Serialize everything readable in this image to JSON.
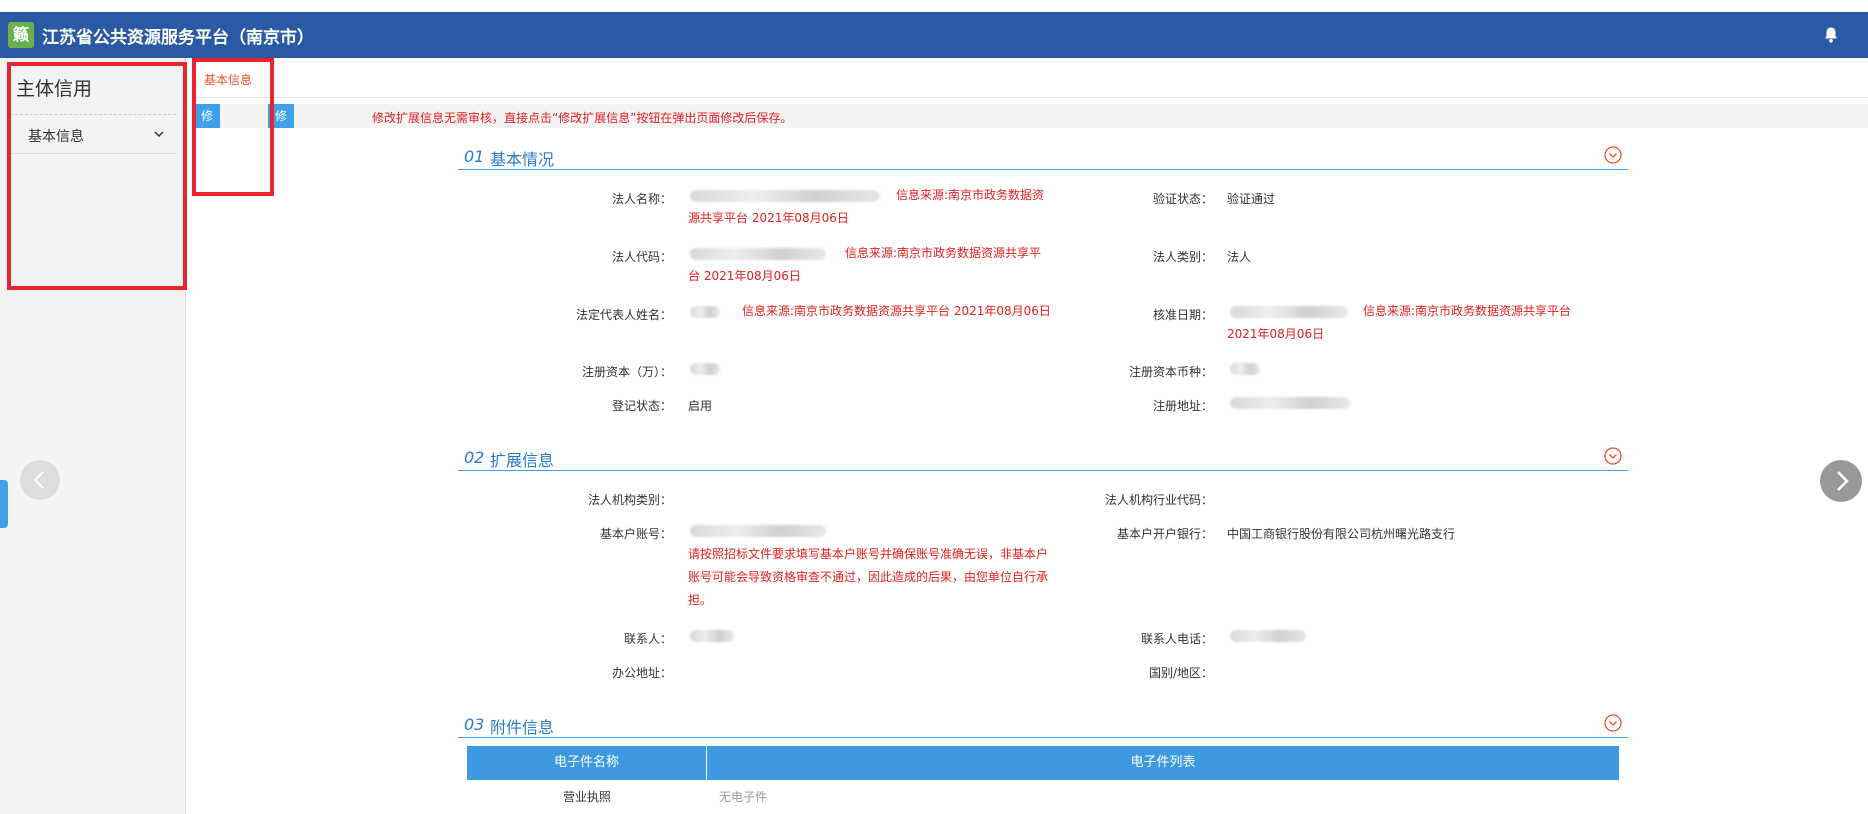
{
  "app": {
    "logo_glyph": "籁",
    "title": "江苏省公共资源服务平台（南京市）"
  },
  "sidebar": {
    "title": "主体信用",
    "items": [
      {
        "label": "基本信息"
      }
    ]
  },
  "tabs": [
    {
      "label": "基本信息"
    }
  ],
  "toolbar": {
    "edit_label": "修改信息",
    "edit_ext_label": "修改扩展信息",
    "hint": "修改扩展信息无需审核，直接点击“修改扩展信息”按钮在弹出页面修改后保存。"
  },
  "basic": {
    "num": "01",
    "name": "基本情况",
    "legal_name_label": "法人名称：",
    "legal_name_src": "信息来源:南京市政务数据资源共享平台 2021年08月06日",
    "verify_label": "验证状态：",
    "verify_value": "验证通过",
    "code_label": "法人代码：",
    "code_src": "信息来源:南京市政务数据资源共享平台 2021年08月06日",
    "type_label": "法人类别：",
    "type_value": "法人",
    "rep_label": "法定代表人姓名：",
    "rep_src": "信息来源:南京市政务数据资源共享平台 2021年08月06日",
    "approve_label": "核准日期：",
    "approve_src": "信息来源:南京市政务数据资源共享平台 2021年08月06日",
    "capital_label": "注册资本（万）：",
    "currency_label": "注册资本币种：",
    "status_label": "登记状态：",
    "status_value": "启用",
    "address_label": "注册地址："
  },
  "extended": {
    "num": "02",
    "name": "扩展信息",
    "org_type_label": "法人机构类别：",
    "industry_label": "法人机构行业代码：",
    "account_label": "基本户账号：",
    "account_warning": "请按照招标文件要求填写基本户账号并确保账号准确无误，非基本户账号可能会导致资格审查不通过，因此造成的后果，由您单位自行承担。",
    "bank_label": "基本户开户银行：",
    "bank_value": "中国工商银行股份有限公司杭州曙光路支行",
    "contact_label": "联系人：",
    "phone_label": "联系人电话：",
    "office_label": "办公地址：",
    "country_label": "国别/地区："
  },
  "attachments": {
    "num": "03",
    "name": "附件信息",
    "col_name": "电子件名称",
    "col_list": "电子件列表",
    "rows": [
      {
        "name": "营业执照",
        "files": "无电子件"
      }
    ]
  },
  "colors": {
    "header": "#2a5aa3",
    "accent": "#3da0e8",
    "warning": "#e02020",
    "highlight_box": "#e8252e"
  },
  "icons": {
    "bell": "bell-icon",
    "chevron": "chevron-down-icon",
    "toggle": "collapse-circle-icon"
  }
}
